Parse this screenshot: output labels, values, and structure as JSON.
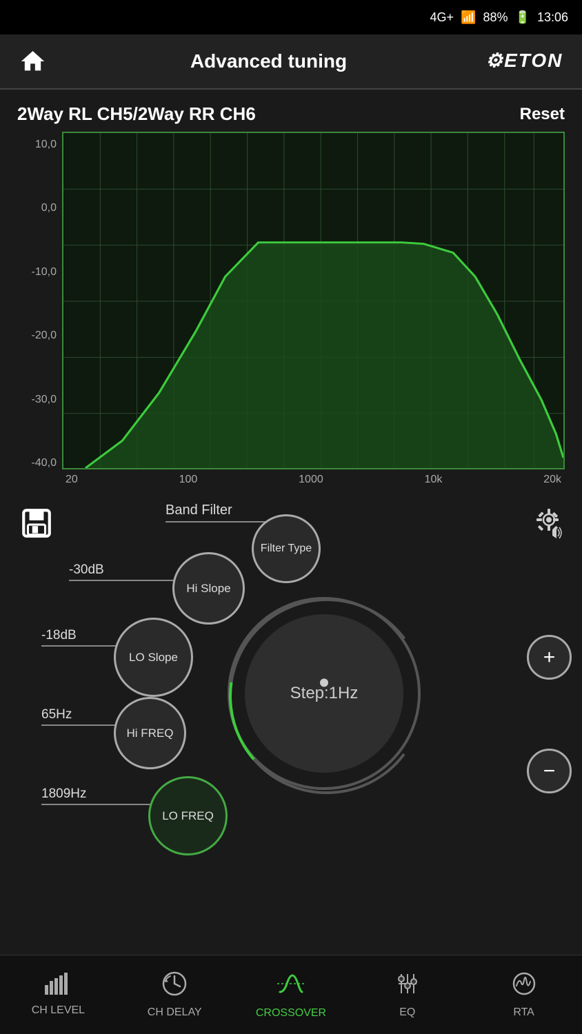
{
  "statusBar": {
    "signal": "4G+",
    "signalBars": "▂▄▆",
    "battery": "88%",
    "time": "13:06"
  },
  "header": {
    "title": "Advanced tuning",
    "logo": "ETON",
    "homeLabel": "home"
  },
  "channel": {
    "title": "2Way RL CH5/2Way RR CH6",
    "resetLabel": "Reset"
  },
  "chart": {
    "yLabels": [
      "10,0",
      "0,0",
      "-10,0",
      "-20,0",
      "-30,0",
      "-40,0"
    ],
    "xLabels": [
      "20",
      "100",
      "1000",
      "10k",
      "20k"
    ]
  },
  "controls": {
    "bandFilterLabel": "Band Filter",
    "filterTypeLabel": "Filter Type",
    "hiSlopeLabel": "-30dB",
    "hiSlopeKnob": "Hi Slope",
    "loSlopeLabel": "-18dB",
    "loSlopeKnob": "LO Slope",
    "hiFreqLabel": "65Hz",
    "hiFreqKnob": "Hi FREQ",
    "loFreqLabel": "1809Hz",
    "loFreqKnob": "LO FREQ",
    "stepLabel": "Step:1Hz",
    "plusLabel": "+",
    "minusLabel": "−"
  },
  "bottomNav": {
    "items": [
      {
        "id": "ch-level",
        "label": "CH LEVEL",
        "active": false
      },
      {
        "id": "ch-delay",
        "label": "CH DELAY",
        "active": false
      },
      {
        "id": "crossover",
        "label": "CROSSOVER",
        "active": true
      },
      {
        "id": "eq",
        "label": "EQ",
        "active": false
      },
      {
        "id": "rta",
        "label": "RTA",
        "active": false
      }
    ]
  }
}
